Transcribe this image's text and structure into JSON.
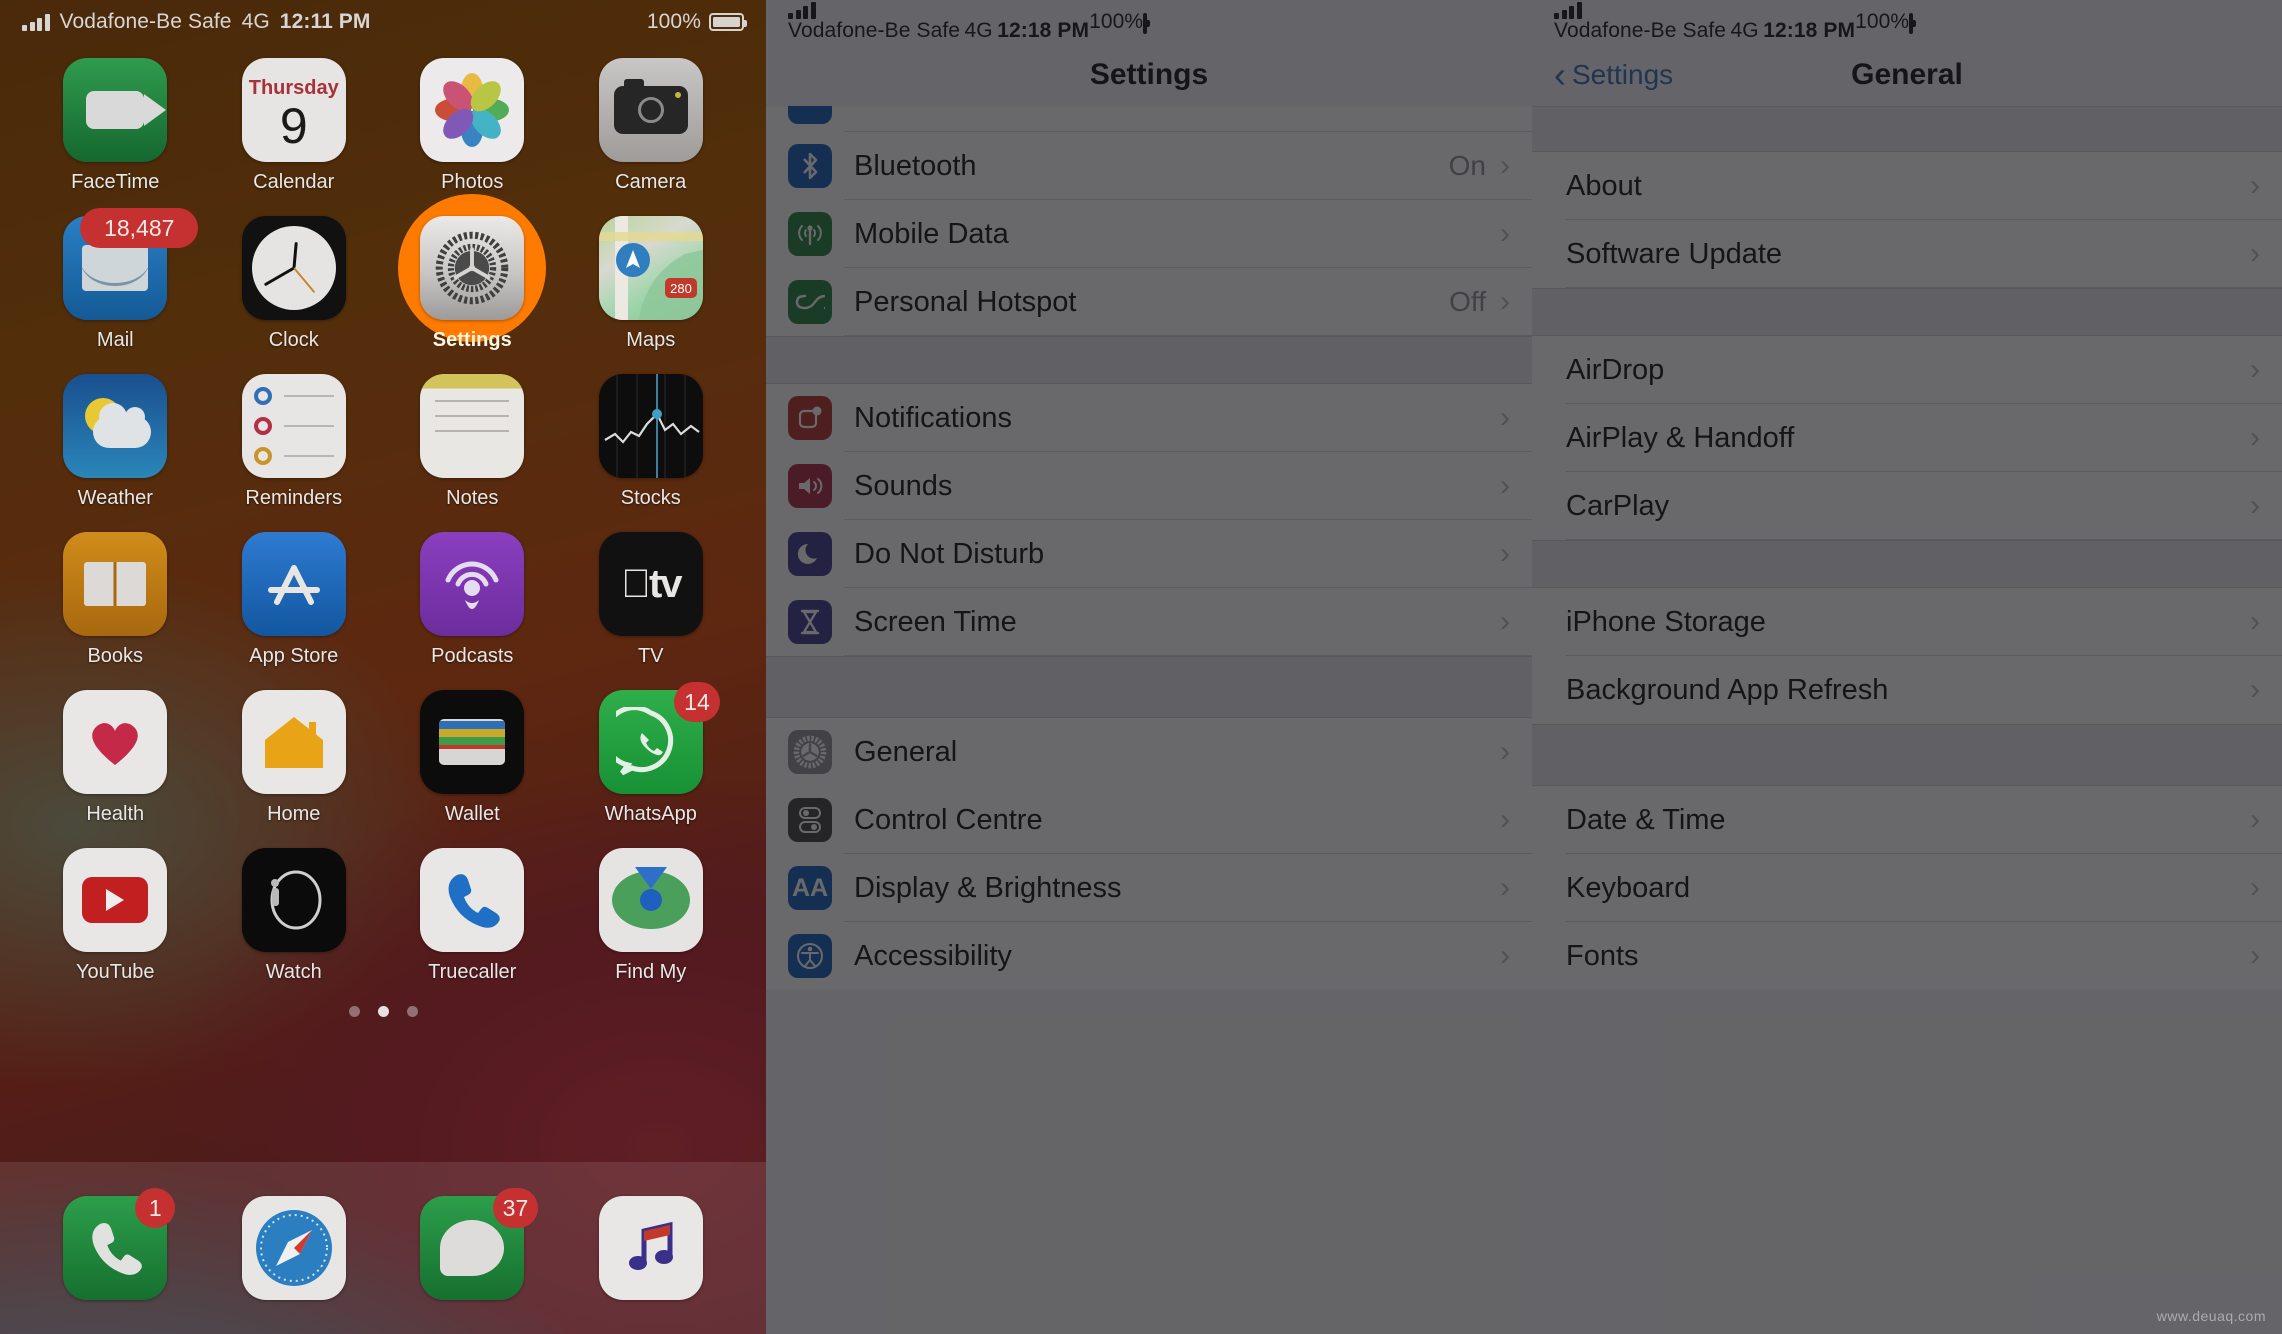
{
  "home": {
    "status": {
      "signal": "signal-bars",
      "carrier": "Vodafone-Be Safe",
      "network": "4G",
      "time": "12:11 PM",
      "battery_percent": "100%"
    },
    "apps": [
      {
        "name": "FaceTime",
        "icon": "facetime-icon",
        "badge": null
      },
      {
        "name": "Calendar",
        "icon": "calendar-icon",
        "badge": null,
        "day": "Thursday",
        "date": "9"
      },
      {
        "name": "Photos",
        "icon": "photos-icon",
        "badge": null
      },
      {
        "name": "Camera",
        "icon": "camera-icon",
        "badge": null
      },
      {
        "name": "Mail",
        "icon": "mail-icon",
        "badge": "18,487"
      },
      {
        "name": "Clock",
        "icon": "clock-icon",
        "badge": null
      },
      {
        "name": "Settings",
        "icon": "settings-gear-icon",
        "badge": null,
        "highlighted": true
      },
      {
        "name": "Maps",
        "icon": "maps-icon",
        "badge": null,
        "shield": "280"
      },
      {
        "name": "Weather",
        "icon": "weather-icon",
        "badge": null
      },
      {
        "name": "Reminders",
        "icon": "reminders-icon",
        "badge": null
      },
      {
        "name": "Notes",
        "icon": "notes-icon",
        "badge": null
      },
      {
        "name": "Stocks",
        "icon": "stocks-icon",
        "badge": null
      },
      {
        "name": "Books",
        "icon": "books-icon",
        "badge": null
      },
      {
        "name": "App Store",
        "icon": "app-store-icon",
        "badge": null
      },
      {
        "name": "Podcasts",
        "icon": "podcasts-icon",
        "badge": null
      },
      {
        "name": "TV",
        "icon": "apple-tv-icon",
        "badge": null,
        "glyph": "tv"
      },
      {
        "name": "Health",
        "icon": "health-heart-icon",
        "badge": null
      },
      {
        "name": "Home",
        "icon": "home-house-icon",
        "badge": null
      },
      {
        "name": "Wallet",
        "icon": "wallet-icon",
        "badge": null
      },
      {
        "name": "WhatsApp",
        "icon": "whatsapp-icon",
        "badge": "14"
      },
      {
        "name": "YouTube",
        "icon": "youtube-icon",
        "badge": null
      },
      {
        "name": "Watch",
        "icon": "apple-watch-icon",
        "badge": null
      },
      {
        "name": "Truecaller",
        "icon": "truecaller-icon",
        "badge": null
      },
      {
        "name": "Find My",
        "icon": "find-my-icon",
        "badge": null
      }
    ],
    "page_dots": {
      "count": 3,
      "active_index": 1
    },
    "dock": [
      {
        "name": "Phone",
        "icon": "phone-icon",
        "badge": "1"
      },
      {
        "name": "Safari",
        "icon": "safari-compass-icon",
        "badge": null
      },
      {
        "name": "Messages",
        "icon": "messages-icon",
        "badge": "37"
      },
      {
        "name": "Music",
        "icon": "music-note-icon",
        "badge": null
      }
    ]
  },
  "settings": {
    "status": {
      "carrier": "Vodafone-Be Safe",
      "network": "4G",
      "time": "12:18 PM",
      "battery_percent": "100%"
    },
    "title": "Settings",
    "rows": [
      {
        "label": "Bluetooth",
        "value": "On",
        "icon": "bluetooth-icon",
        "glyph": "ᛗ",
        "icon_class": "ri-bluetooth",
        "chevron": "›"
      },
      {
        "label": "Mobile Data",
        "value": "",
        "icon": "mobile-data-icon",
        "glyph": "((↑))",
        "icon_class": "ri-mobiledata",
        "chevron": "›"
      },
      {
        "label": "Personal Hotspot",
        "value": "Off",
        "icon": "personal-hotspot-icon",
        "glyph": "∞",
        "icon_class": "ri-hotspot",
        "chevron": "›"
      },
      {
        "label": "Notifications",
        "value": "",
        "icon": "notifications-icon",
        "glyph": "▢",
        "icon_class": "ri-notifications",
        "chevron": "›"
      },
      {
        "label": "Sounds",
        "value": "",
        "icon": "sounds-icon",
        "glyph": "◂))",
        "icon_class": "ri-sounds",
        "chevron": "›"
      },
      {
        "label": "Do Not Disturb",
        "value": "",
        "icon": "do-not-disturb-moon-icon",
        "glyph": "☽",
        "icon_class": "ri-dnd",
        "chevron": "›"
      },
      {
        "label": "Screen Time",
        "value": "",
        "icon": "screen-time-hourglass-icon",
        "glyph": "⧗",
        "icon_class": "ri-screentime",
        "chevron": "›"
      },
      {
        "label": "General",
        "value": "",
        "icon": "general-gear-icon",
        "glyph": "⚙",
        "icon_class": "ri-general",
        "chevron": "›",
        "highlighted": true
      },
      {
        "label": "Control Centre",
        "value": "",
        "icon": "control-centre-icon",
        "glyph": "◎",
        "icon_class": "ri-control",
        "chevron": "›"
      },
      {
        "label": "Display & Brightness",
        "value": "",
        "icon": "display-brightness-icon",
        "glyph": "AA",
        "icon_class": "ri-display",
        "chevron": "›"
      },
      {
        "label": "Accessibility",
        "value": "",
        "icon": "accessibility-icon",
        "glyph": "☺",
        "icon_class": "ri-access",
        "chevron": "›"
      }
    ]
  },
  "general": {
    "status": {
      "carrier": "Vodafone-Be Safe",
      "network": "4G",
      "time": "12:18 PM",
      "battery_percent": "100%"
    },
    "back_label": "Settings",
    "back_chevron": "‹",
    "title": "General",
    "rows": [
      {
        "label": "About",
        "chevron": "›"
      },
      {
        "label": "Software Update",
        "chevron": "›"
      },
      {
        "label": "AirDrop",
        "chevron": "›"
      },
      {
        "label": "AirPlay & Handoff",
        "chevron": "›"
      },
      {
        "label": "CarPlay",
        "chevron": "›"
      },
      {
        "label": "iPhone Storage",
        "chevron": "›"
      },
      {
        "label": "Background App Refresh",
        "chevron": "›",
        "highlighted": true
      },
      {
        "label": "Date & Time",
        "chevron": "›"
      },
      {
        "label": "Keyboard",
        "chevron": "›"
      },
      {
        "label": "Fonts",
        "chevron": "›"
      }
    ]
  },
  "watermark": "www.deuaq.com",
  "colors": {
    "highlight_orange": "#FF7A00",
    "ios_blue": "#2b66b0",
    "row_white": "#ffffff",
    "group_gap": "#e6e5ea",
    "overlay": "rgba(28,28,30,0.66)"
  }
}
